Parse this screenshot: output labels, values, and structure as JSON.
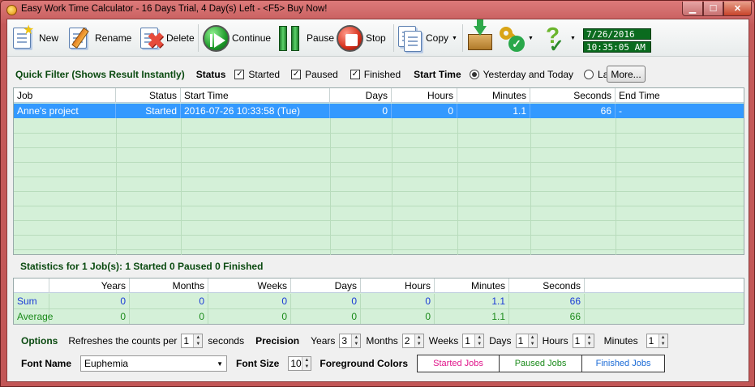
{
  "window": {
    "title": "Easy Work Time Calculator - 16 Days Trial, 4 Day(s) Left - <F5> Buy Now!"
  },
  "toolbar": {
    "new": "New",
    "rename": "Rename",
    "delete": "Delete",
    "continue": "Continue",
    "pause": "Pause",
    "stop": "Stop",
    "copy": "Copy",
    "date": "7/26/2016",
    "time": "10:35:05 AM"
  },
  "filter": {
    "quick_filter": "Quick Filter (Shows Result Instantly)",
    "status_label": "Status",
    "started": "Started",
    "paused": "Paused",
    "finished": "Finished",
    "start_time_label": "Start Time",
    "yesterday_today": "Yesterday and Today",
    "last_week": "Last Week",
    "more": "More..."
  },
  "jobs": {
    "columns": [
      "Job",
      "Status",
      "Start Time",
      "Days",
      "Hours",
      "Minutes",
      "Seconds",
      "End Time"
    ],
    "rows": [
      {
        "job": "Anne's project",
        "status": "Started",
        "start": "2016-07-26 10:33:58 (Tue)",
        "days": "0",
        "hours": "0",
        "minutes": "1.1",
        "seconds": "66",
        "end": "-"
      }
    ]
  },
  "stats": {
    "title": "Statistics for 1 Job(s): 1 Started 0 Paused 0 Finished",
    "columns": [
      "",
      "Years",
      "Months",
      "Weeks",
      "Days",
      "Hours",
      "Minutes",
      "Seconds"
    ],
    "sum": {
      "label": "Sum",
      "years": "0",
      "months": "0",
      "weeks": "0",
      "days": "0",
      "hours": "0",
      "minutes": "1.1",
      "seconds": "66"
    },
    "average": {
      "label": "Average",
      "years": "0",
      "months": "0",
      "weeks": "0",
      "days": "0",
      "hours": "0",
      "minutes": "1.1",
      "seconds": "66"
    }
  },
  "options": {
    "label": "Options",
    "refresh_label": "Refreshes the counts per",
    "refresh_value": "1",
    "seconds_label": "seconds",
    "precision_label": "Precision",
    "years_label": "Years",
    "years_value": "3",
    "months_label": "Months",
    "months_value": "2",
    "weeks_label": "Weeks",
    "weeks_value": "1",
    "days_label": "Days",
    "days_value": "1",
    "hours_label": "Hours",
    "hours_value": "1",
    "minutes_label": "Minutes",
    "minutes_value": "1",
    "font_name_label": "Font Name",
    "font_name_value": "Euphemia",
    "font_size_label": "Font Size",
    "font_size_value": "10",
    "fg_colors_label": "Foreground Colors",
    "started_jobs": "Started Jobs",
    "paused_jobs": "Paused Jobs",
    "finished_jobs": "Finished Jobs"
  },
  "colors": {
    "started": "#e0158a",
    "paused": "#1a8a1a",
    "finished": "#1a6ad6",
    "sum": "#1a3ad6",
    "average": "#1a8a1a"
  }
}
